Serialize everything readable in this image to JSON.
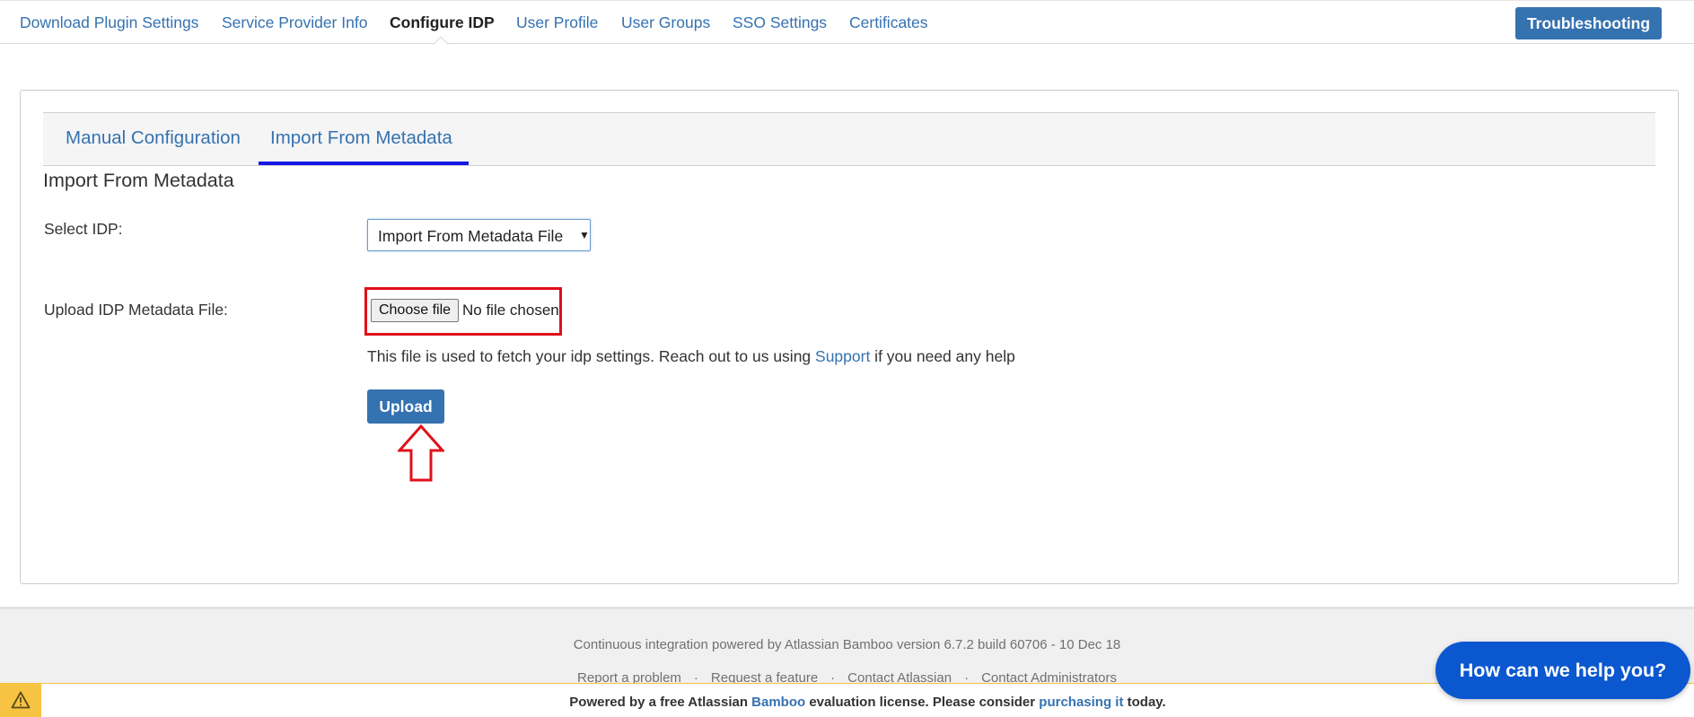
{
  "nav": {
    "items": [
      {
        "label": "Download Plugin Settings",
        "active": false
      },
      {
        "label": "Service Provider Info",
        "active": false
      },
      {
        "label": "Configure IDP",
        "active": true
      },
      {
        "label": "User Profile",
        "active": false
      },
      {
        "label": "User Groups",
        "active": false
      },
      {
        "label": "SSO Settings",
        "active": false
      },
      {
        "label": "Certificates",
        "active": false
      }
    ],
    "troubleshooting_label": "Troubleshooting"
  },
  "tabs": [
    {
      "label": "Manual Configuration",
      "active": false
    },
    {
      "label": "Import From Metadata",
      "active": true
    }
  ],
  "section_title": "Import From Metadata",
  "form": {
    "select_idp": {
      "label": "Select IDP:",
      "value": "Import From Metadata File",
      "icon": "chevron-down-icon"
    },
    "upload_file": {
      "label": "Upload IDP Metadata File:",
      "button_label": "Choose file",
      "status": "No file chosen"
    },
    "help": {
      "before": "This file is used to fetch your idp settings. Reach out to us using ",
      "link": "Support",
      "after": " if you need any help"
    },
    "upload_button": "Upload"
  },
  "annotations": {
    "highlight_color": "#e0101a",
    "arrow_icon": "up-arrow-icon"
  },
  "footer": {
    "powered_by": "Continuous integration powered by Atlassian Bamboo version 6.7.2 build 60706 - 10 Dec 18",
    "links": [
      "Report a problem",
      "Request a feature",
      "Contact Atlassian",
      "Contact Administrators"
    ],
    "separator": "·"
  },
  "license_bar": {
    "icon": "warning-icon",
    "before": "Powered by a free Atlassian ",
    "product": "Bamboo",
    "middle": " evaluation license. Please consider ",
    "link": "purchasing it",
    "after": " today."
  },
  "help_widget": {
    "label": "How can we help you?"
  },
  "colors": {
    "link": "#3572b0",
    "primary_button": "#3572b0",
    "active_tab_underline": "#1717e8",
    "warning": "#f6c342",
    "help_widget": "#0b57d0"
  }
}
